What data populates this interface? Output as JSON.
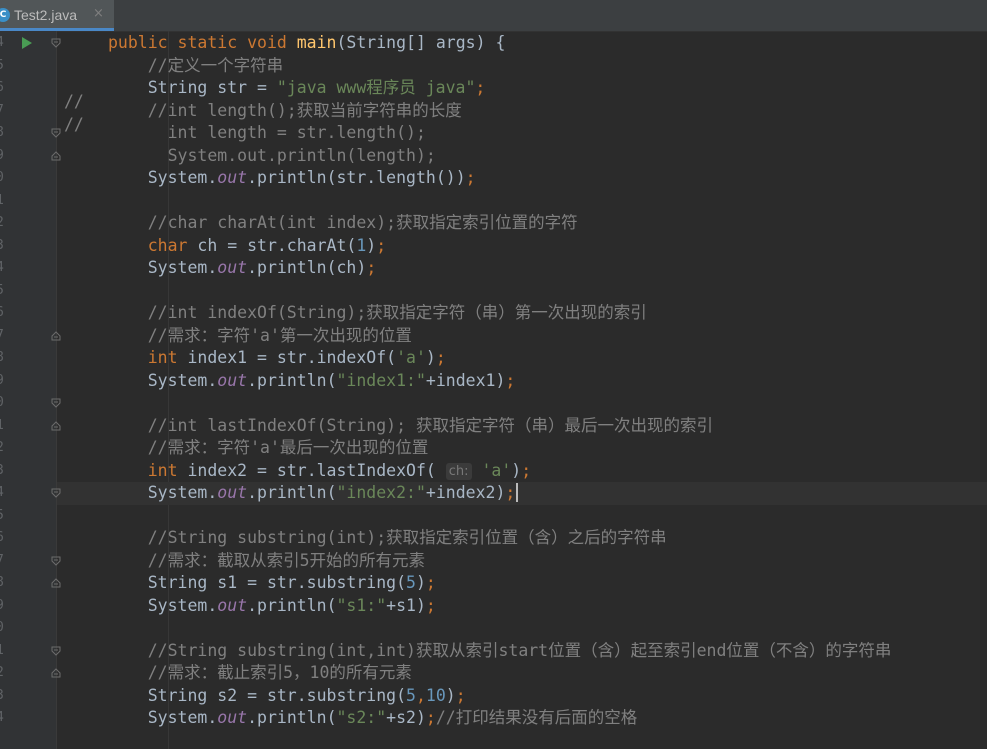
{
  "tab": {
    "filename": "Test2.java",
    "icon": "C",
    "close": "×"
  },
  "gutter_comments": [
    "//",
    "//"
  ],
  "lines": [
    {
      "num": "4",
      "segments": [
        [
          "k",
          "public static void "
        ],
        [
          "f",
          "main"
        ],
        [
          "",
          "(String[] args) {"
        ]
      ]
    },
    {
      "num": "5",
      "segments": [
        [
          "c",
          "    //定义一个字符串"
        ]
      ]
    },
    {
      "num": "6",
      "segments": [
        [
          "",
          "    String str = "
        ],
        [
          "s",
          "\"java www程序员 java\""
        ],
        [
          "k",
          ";"
        ]
      ]
    },
    {
      "num": "7",
      "segments": [
        [
          "c",
          "    //int length();获取当前字符串的长度"
        ]
      ]
    },
    {
      "num": "8",
      "segments": [
        [
          "c",
          "      int length = str.length();"
        ]
      ]
    },
    {
      "num": "9",
      "segments": [
        [
          "c",
          "      System.out.println(length);"
        ]
      ]
    },
    {
      "num": "0",
      "segments": [
        [
          "",
          "    System."
        ],
        [
          "o",
          "out"
        ],
        [
          "",
          ".println(str.length())"
        ],
        [
          "k",
          ";"
        ]
      ]
    },
    {
      "num": "1",
      "segments": []
    },
    {
      "num": "2",
      "segments": [
        [
          "c",
          "    //char charAt(int index);获取指定索引位置的字符"
        ]
      ]
    },
    {
      "num": "3",
      "segments": [
        [
          "k",
          "    char "
        ],
        [
          "",
          "ch = str.charAt("
        ],
        [
          "n",
          "1"
        ],
        [
          "",
          ")"
        ],
        [
          "k",
          ";"
        ]
      ]
    },
    {
      "num": "4",
      "segments": [
        [
          "",
          "    System."
        ],
        [
          "o",
          "out"
        ],
        [
          "",
          ".println(ch)"
        ],
        [
          "k",
          ";"
        ]
      ]
    },
    {
      "num": "5",
      "segments": []
    },
    {
      "num": "6",
      "segments": [
        [
          "c",
          "    //int indexOf(String);获取指定字符（串）第一次出现的索引"
        ]
      ]
    },
    {
      "num": "7",
      "segments": [
        [
          "c",
          "    //需求：字符'a'第一次出现的位置"
        ]
      ]
    },
    {
      "num": "8",
      "segments": [
        [
          "k",
          "    int "
        ],
        [
          "",
          "index1 = str.indexOf("
        ],
        [
          "s",
          "'a'"
        ],
        [
          "",
          ")"
        ],
        [
          "k",
          ";"
        ]
      ]
    },
    {
      "num": "9",
      "segments": [
        [
          "",
          "    System."
        ],
        [
          "o",
          "out"
        ],
        [
          "",
          ".println("
        ],
        [
          "s",
          "\"index1:\""
        ],
        [
          "",
          "+index1)"
        ],
        [
          "k",
          ";"
        ]
      ]
    },
    {
      "num": "0",
      "segments": []
    },
    {
      "num": "1",
      "segments": [
        [
          "c",
          "    //int lastIndexOf(String); 获取指定字符（串）最后一次出现的索引"
        ]
      ]
    },
    {
      "num": "2",
      "segments": [
        [
          "c",
          "    //需求：字符'a'最后一次出现的位置"
        ]
      ]
    },
    {
      "num": "3",
      "segments": [
        [
          "k",
          "    int "
        ],
        [
          "",
          "index2 = str.lastIndexOf( "
        ],
        [
          "hint",
          "ch:"
        ],
        [
          "",
          " "
        ],
        [
          "s",
          "'a'"
        ],
        [
          "",
          ")"
        ],
        [
          "k",
          ";"
        ]
      ]
    },
    {
      "num": "4",
      "segments": [
        [
          "",
          "    System."
        ],
        [
          "o",
          "out"
        ],
        [
          "",
          ".println("
        ],
        [
          "s",
          "\"index2:\""
        ],
        [
          "",
          "+index2)"
        ],
        [
          "k",
          ";"
        ],
        [
          "caret",
          ""
        ]
      ]
    },
    {
      "num": "5",
      "segments": []
    },
    {
      "num": "6",
      "segments": [
        [
          "c",
          "    //String substring(int);获取指定索引位置（含）之后的字符串"
        ]
      ]
    },
    {
      "num": "7",
      "segments": [
        [
          "c",
          "    //需求：截取从索引5开始的所有元素"
        ]
      ]
    },
    {
      "num": "8",
      "segments": [
        [
          "",
          "    String s1 = str.substring("
        ],
        [
          "n",
          "5"
        ],
        [
          "",
          ")"
        ],
        [
          "k",
          ";"
        ]
      ]
    },
    {
      "num": "9",
      "segments": [
        [
          "",
          "    System."
        ],
        [
          "o",
          "out"
        ],
        [
          "",
          ".println("
        ],
        [
          "s",
          "\"s1:\""
        ],
        [
          "",
          "+s1)"
        ],
        [
          "k",
          ";"
        ]
      ]
    },
    {
      "num": "0",
      "segments": []
    },
    {
      "num": "1",
      "segments": [
        [
          "c",
          "    //String substring(int,int)获取从索引start位置（含）起至索引end位置（不含）的字符串"
        ]
      ]
    },
    {
      "num": "2",
      "segments": [
        [
          "c",
          "    //需求：截止索引5，10的所有元素"
        ]
      ]
    },
    {
      "num": "3",
      "segments": [
        [
          "",
          "    String s2 = str.substring("
        ],
        [
          "n",
          "5"
        ],
        [
          "k",
          ","
        ],
        [
          "n",
          "10"
        ],
        [
          "",
          ")"
        ],
        [
          "k",
          ";"
        ]
      ]
    },
    {
      "num": "4",
      "segments": [
        [
          "",
          "    System."
        ],
        [
          "o",
          "out"
        ],
        [
          "",
          ".println("
        ],
        [
          "s",
          "\"s2:\""
        ],
        [
          "",
          "+s2)"
        ],
        [
          "k",
          ";"
        ],
        [
          "c",
          "//打印结果没有后面的空格"
        ]
      ]
    }
  ]
}
